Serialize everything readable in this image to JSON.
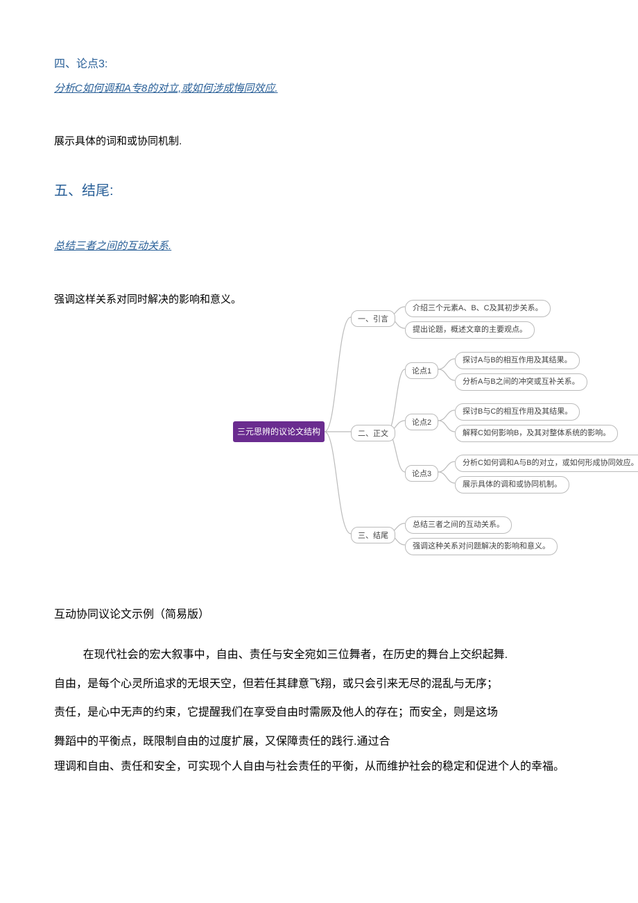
{
  "section4": {
    "heading": "四、论点3:",
    "italic": "分析C如何调和A专8的对立,或如何涉成悔同效应.",
    "body": "展示具体的词和或协同机制."
  },
  "section5": {
    "heading": "五、结尾:",
    "italic": "总结三者之间的互动关系.",
    "body": "强调这样关系对同时解决的影响和意义。"
  },
  "mindmap": {
    "root": "三元思辨的议论文结构",
    "b1": {
      "label": "一、引言",
      "leaves": [
        "介绍三个元素A、B、C及其初步关系。",
        "提出论题，概述文章的主要观点。"
      ]
    },
    "b2": {
      "label": "二、正文",
      "sub": [
        {
          "label": "论点1",
          "leaves": [
            "探讨A与B的相互作用及其结果。",
            "分析A与B之间的冲突或互补关系。"
          ]
        },
        {
          "label": "论点2",
          "leaves": [
            "探讨B与C的相互作用及其结果。",
            "解释C如何影响B，及其对整体系统的影响。"
          ]
        },
        {
          "label": "论点3",
          "leaves": [
            "分析C如何调和A与B的对立，或如何形成协同效应。",
            "展示具体的调和或协同机制。"
          ]
        }
      ]
    },
    "b3": {
      "label": "三、结尾",
      "leaves": [
        "总结三者之间的互动关系。",
        "强调这种关系对问题解决的影响和意义。"
      ]
    }
  },
  "example": {
    "title": "互动协同议论文示例（简易版）",
    "p1a": "在现代社会的宏大叙事中，自由、责任与安全宛如三位舞者，在历史的舞台上交织起舞.",
    "p1b": "自由，是每个心灵所追求的无垠天空，但若任其肆意飞翔，或只会引来无尽的混乱与无序；",
    "p1c": "责任，是心中无声的约束，它提醒我们在享受自由时需厥及他人的存在；而安全，则是这场",
    "p1d": "舞蹈中的平衡点，既限制自由的过度扩展，又保障责任的践行.通过合",
    "p2": "理调和自由、责任和安全，可实现个人自由与社会责任的平衡，从而维护社会的稳定和促进个人的幸福。"
  }
}
